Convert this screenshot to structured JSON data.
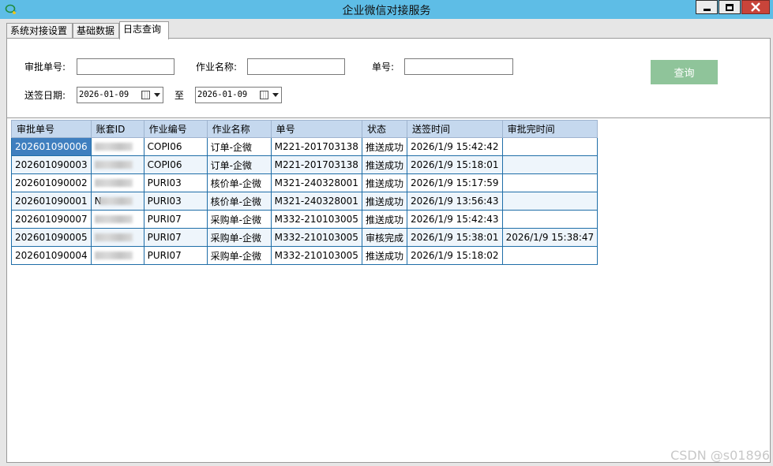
{
  "window": {
    "title": "企业微信对接服务",
    "icon": "wechat-work-icon"
  },
  "tabs": [
    {
      "label": "系统对接设置",
      "active": false
    },
    {
      "label": "基础数据",
      "active": false
    },
    {
      "label": "日志查询",
      "active": true
    }
  ],
  "filters": {
    "approval_no_label": "审批单号:",
    "approval_no_value": "",
    "job_name_label": "作业名称:",
    "job_name_value": "",
    "doc_no_label": "单号:",
    "doc_no_value": "",
    "send_date_label": "送签日期:",
    "date_from": "2026-01-09",
    "to_label": "至",
    "date_to": "2026-01-09",
    "query_label": "查询"
  },
  "table": {
    "columns": [
      "审批单号",
      "账套ID",
      "作业编号",
      "作业名称",
      "单号",
      "状态",
      "送签时间",
      "审批完时间"
    ],
    "rows": [
      [
        "202601090006",
        "",
        "COPI06",
        "订单-企微",
        "M221-201703138",
        "推送成功",
        "2026/1/9 15:42:42",
        ""
      ],
      [
        "202601090003",
        "",
        "COPI06",
        "订单-企微",
        "M221-201703138",
        "推送成功",
        "2026/1/9 15:18:01",
        ""
      ],
      [
        "202601090002",
        "",
        "PURI03",
        "核价单-企微",
        "M321-240328001",
        "推送成功",
        "2026/1/9 15:17:59",
        ""
      ],
      [
        "202601090001",
        "N",
        "PURI03",
        "核价单-企微",
        "M321-240328001",
        "推送成功",
        "2026/1/9 13:56:43",
        ""
      ],
      [
        "202601090007",
        "",
        "PURI07",
        "采购单-企微",
        "M332-210103005",
        "推送成功",
        "2026/1/9 15:42:43",
        ""
      ],
      [
        "202601090005",
        "",
        "PURI07",
        "采购单-企微",
        "M332-210103005",
        "审核完成",
        "2026/1/9 15:38:01",
        "2026/1/9 15:38:47"
      ],
      [
        "202601090004",
        "",
        "PURI07",
        "采购单-企微",
        "M332-210103005",
        "推送成功",
        "2026/1/9 15:18:02",
        ""
      ]
    ],
    "selected_row": 0
  },
  "watermark": "CSDN @s01896",
  "colors": {
    "titlebar": "#5ebde6",
    "header": "#c5d8ee",
    "grid_border": "#1f6ea8",
    "selected": "#3f7fbf",
    "query_button": "#8fc49a"
  }
}
